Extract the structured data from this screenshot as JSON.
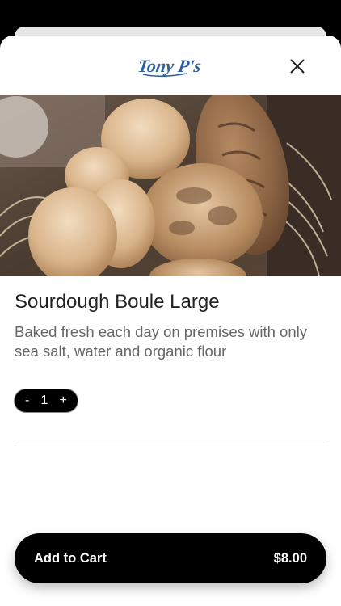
{
  "header": {
    "logo_text": "Tony P's",
    "close_icon": "close-icon"
  },
  "product": {
    "image_icon": "bread-basket-image",
    "name": "Sourdough Boule Large",
    "description": "Baked fresh each day on premises with only sea salt, water and organic flour"
  },
  "quantity": {
    "decrement_label": "-",
    "value": "1",
    "increment_label": "+"
  },
  "cart_button": {
    "label": "Add to Cart",
    "price": "$8.00"
  },
  "colors": {
    "logo_blue": "#2f5fa0",
    "button_bg": "#000000",
    "title_text": "#222222",
    "description_text": "#666666"
  }
}
